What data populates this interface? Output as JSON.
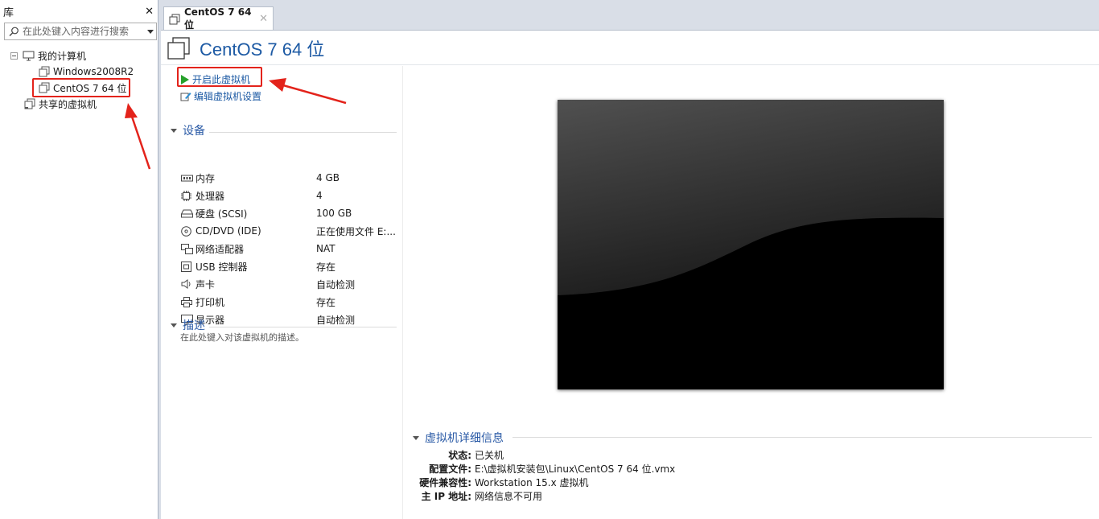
{
  "library": {
    "title": "库",
    "close": "✕",
    "search_placeholder": "在此处键入内容进行搜索",
    "tree": {
      "my_computer": "我的计算机",
      "vm1": "Windows2008R2",
      "vm2": "CentOS 7 64 位",
      "shared": "共享的虚拟机"
    }
  },
  "tab": {
    "label": "CentOS 7 64 位",
    "close": "✕"
  },
  "vm": {
    "title": "CentOS 7 64 位",
    "actions": {
      "power_on": "开启此虚拟机",
      "edit_settings": "编辑虚拟机设置"
    },
    "devices_title": "设备",
    "devices": [
      {
        "name": "内存",
        "value": "4 GB",
        "icon": "memory-icon"
      },
      {
        "name": "处理器",
        "value": "4",
        "icon": "processor-icon"
      },
      {
        "name": "硬盘 (SCSI)",
        "value": "100 GB",
        "icon": "hard-disk-icon"
      },
      {
        "name": "CD/DVD (IDE)",
        "value": "正在使用文件 E:...",
        "icon": "cd-dvd-icon"
      },
      {
        "name": "网络适配器",
        "value": "NAT",
        "icon": "network-adapter-icon"
      },
      {
        "name": "USB 控制器",
        "value": "存在",
        "icon": "usb-icon"
      },
      {
        "name": "声卡",
        "value": "自动检测",
        "icon": "sound-card-icon"
      },
      {
        "name": "打印机",
        "value": "存在",
        "icon": "printer-icon"
      },
      {
        "name": "显示器",
        "value": "自动检测",
        "icon": "display-icon"
      }
    ],
    "description_title": "描述",
    "description_placeholder": "在此处键入对该虚拟机的描述。",
    "details_title": "虚拟机详细信息",
    "details": [
      {
        "key": "状态:",
        "value": "已关机"
      },
      {
        "key": "配置文件:",
        "value": "E:\\虚拟机安装包\\Linux\\CentOS 7 64 位.vmx"
      },
      {
        "key": "硬件兼容性:",
        "value": "Workstation 15.x 虚拟机"
      },
      {
        "key": "主 IP 地址:",
        "value": "网络信息不可用"
      }
    ]
  },
  "colors": {
    "accent": "#1d5aa4",
    "annotation_red": "#e3231b",
    "play_green": "#27a12b"
  }
}
